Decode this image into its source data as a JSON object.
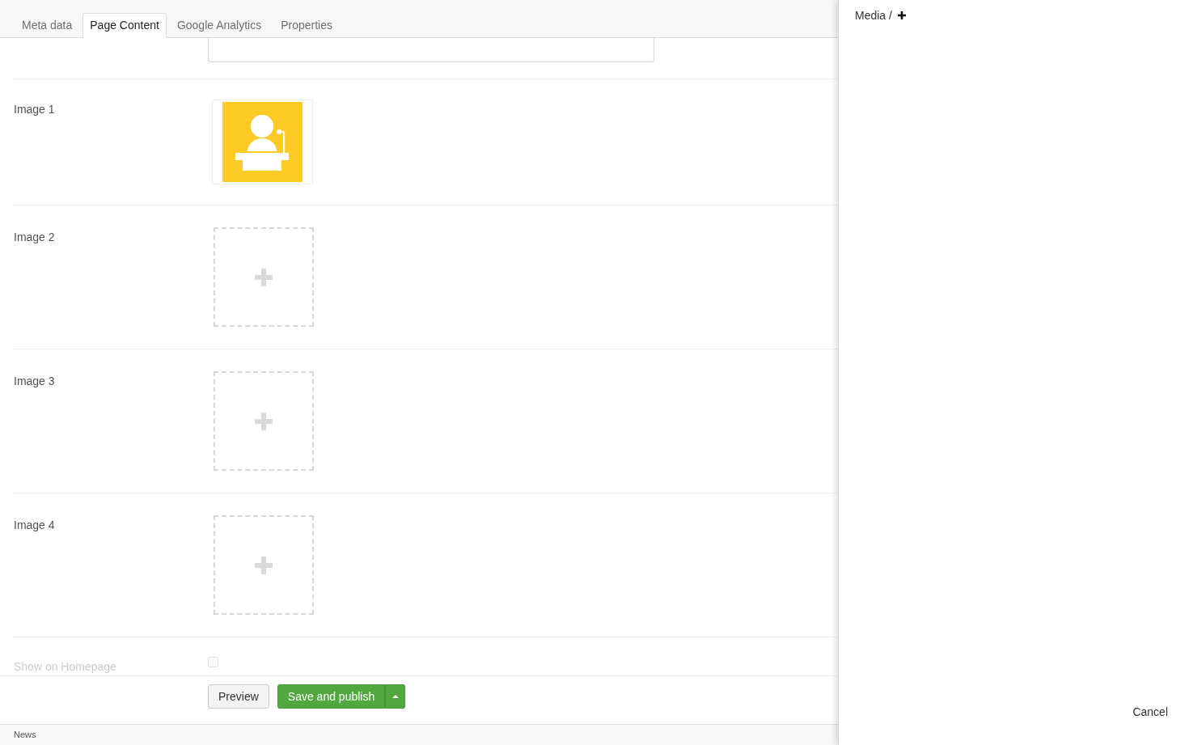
{
  "tabs": [
    {
      "label": "Meta data",
      "selected": false
    },
    {
      "label": "Page Content",
      "selected": true
    },
    {
      "label": "Google Analytics",
      "selected": false
    },
    {
      "label": "Properties",
      "selected": false
    }
  ],
  "properties": [
    {
      "kind": "textfield"
    },
    {
      "kind": "image",
      "label": "Image 1",
      "filled": true
    },
    {
      "kind": "image",
      "label": "Image 2",
      "filled": false
    },
    {
      "kind": "image",
      "label": "Image 3",
      "filled": false
    },
    {
      "kind": "image",
      "label": "Image 4",
      "filled": false
    },
    {
      "kind": "checkbox",
      "label": "Show on Homepage",
      "checked": false
    }
  ],
  "actions": {
    "preview": "Preview",
    "publish": "Save and publish"
  },
  "breadcrumb": "News",
  "media_panel": {
    "title": "Media /",
    "cancel": "Cancel"
  }
}
